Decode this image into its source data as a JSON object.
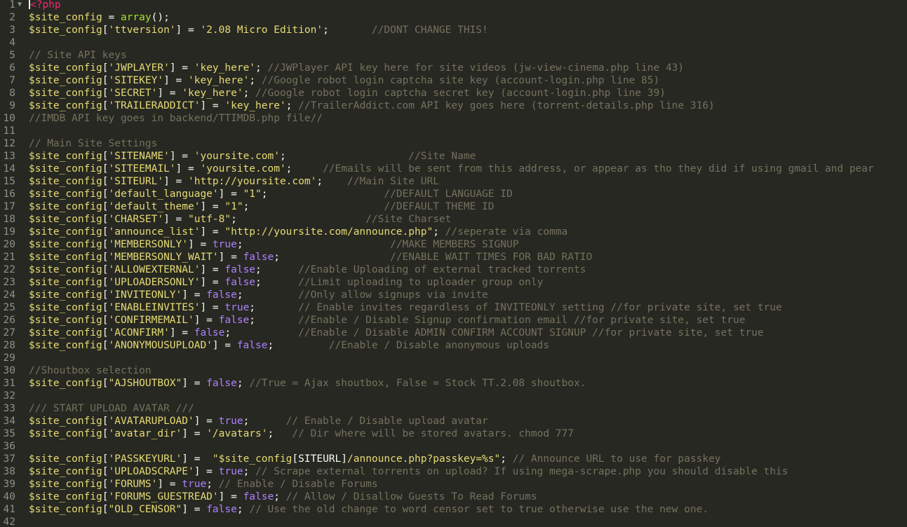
{
  "editor": {
    "colors": {
      "background": "#272822",
      "gutter_text": "#8f908a",
      "plain": "#f8f8f2",
      "variable": "#e6db74",
      "string": "#e6db74",
      "constant": "#ae81ff",
      "function": "#a6e22e",
      "tag": "#f92672",
      "comment": "#75715e"
    },
    "lines": [
      {
        "n": "1",
        "fold": "▼",
        "t": [
          [
            "tag",
            "<?php"
          ]
        ]
      },
      {
        "n": "2",
        "t": [
          [
            "var",
            "$site_config"
          ],
          [
            "plain",
            " = "
          ],
          [
            "fn",
            "array"
          ],
          [
            "plain",
            "();"
          ]
        ]
      },
      {
        "n": "3",
        "t": [
          [
            "var",
            "$site_config"
          ],
          [
            "plain",
            "["
          ],
          [
            "str",
            "'ttversion'"
          ],
          [
            "plain",
            "] = "
          ],
          [
            "str",
            "'2.08 Micro Edition'"
          ],
          [
            "plain",
            ";       "
          ],
          [
            "com",
            "//DONT CHANGE THIS!"
          ]
        ]
      },
      {
        "n": "4",
        "t": []
      },
      {
        "n": "5",
        "t": [
          [
            "com",
            "// Site API keys"
          ]
        ]
      },
      {
        "n": "6",
        "t": [
          [
            "var",
            "$site_config"
          ],
          [
            "plain",
            "["
          ],
          [
            "str",
            "'JWPLAYER'"
          ],
          [
            "plain",
            "] = "
          ],
          [
            "str",
            "'key_here'"
          ],
          [
            "plain",
            "; "
          ],
          [
            "com",
            "//JWPlayer API key here for site videos (jw-view-cinema.php line 43)"
          ]
        ]
      },
      {
        "n": "7",
        "t": [
          [
            "var",
            "$site_config"
          ],
          [
            "plain",
            "["
          ],
          [
            "str",
            "'SITEKEY'"
          ],
          [
            "plain",
            "] = "
          ],
          [
            "str",
            "'key_here'"
          ],
          [
            "plain",
            "; "
          ],
          [
            "com",
            "//Google robot login captcha site key (account-login.php line 85)"
          ]
        ]
      },
      {
        "n": "8",
        "t": [
          [
            "var",
            "$site_config"
          ],
          [
            "plain",
            "["
          ],
          [
            "str",
            "'SECRET'"
          ],
          [
            "plain",
            "] = "
          ],
          [
            "str",
            "'key_here'"
          ],
          [
            "plain",
            "; "
          ],
          [
            "com",
            "//Google robot login captcha secret key (account-login.php line 39)"
          ]
        ]
      },
      {
        "n": "9",
        "t": [
          [
            "var",
            "$site_config"
          ],
          [
            "plain",
            "["
          ],
          [
            "str",
            "'TRAILERADDICT'"
          ],
          [
            "plain",
            "] = "
          ],
          [
            "str",
            "'key_here'"
          ],
          [
            "plain",
            "; "
          ],
          [
            "com",
            "//TrailerAddict.com API key goes here (torrent-details.php line 316)"
          ]
        ]
      },
      {
        "n": "10",
        "t": [
          [
            "com",
            "//IMDB API key goes in backend/TTIMDB.php file//"
          ]
        ]
      },
      {
        "n": "11",
        "t": []
      },
      {
        "n": "12",
        "t": [
          [
            "com",
            "// Main Site Settings"
          ]
        ]
      },
      {
        "n": "13",
        "t": [
          [
            "var",
            "$site_config"
          ],
          [
            "plain",
            "["
          ],
          [
            "str",
            "'SITENAME'"
          ],
          [
            "plain",
            "] = "
          ],
          [
            "str",
            "'yoursite.com'"
          ],
          [
            "plain",
            ";                    "
          ],
          [
            "com",
            "//Site Name"
          ]
        ]
      },
      {
        "n": "14",
        "t": [
          [
            "var",
            "$site_config"
          ],
          [
            "plain",
            "["
          ],
          [
            "str",
            "'SITEEMAIL'"
          ],
          [
            "plain",
            "] = "
          ],
          [
            "str",
            "'yoursite.com'"
          ],
          [
            "plain",
            ";     "
          ],
          [
            "com",
            "//Emails will be sent from this address, or appear as tho they did if using gmail and pear"
          ]
        ]
      },
      {
        "n": "15",
        "t": [
          [
            "var",
            "$site_config"
          ],
          [
            "plain",
            "["
          ],
          [
            "str",
            "'SITEURL'"
          ],
          [
            "plain",
            "] = "
          ],
          [
            "str",
            "'http://yoursite.com'"
          ],
          [
            "plain",
            ";    "
          ],
          [
            "com",
            "//Main Site URL"
          ]
        ]
      },
      {
        "n": "16",
        "t": [
          [
            "var",
            "$site_config"
          ],
          [
            "plain",
            "["
          ],
          [
            "str",
            "'default_language'"
          ],
          [
            "plain",
            "] = "
          ],
          [
            "str",
            "\"1\""
          ],
          [
            "plain",
            ";                   "
          ],
          [
            "com",
            "//DEFAULT LANGUAGE ID"
          ]
        ]
      },
      {
        "n": "17",
        "t": [
          [
            "var",
            "$site_config"
          ],
          [
            "plain",
            "["
          ],
          [
            "str",
            "'default_theme'"
          ],
          [
            "plain",
            "] = "
          ],
          [
            "str",
            "\"1\""
          ],
          [
            "plain",
            ";                      "
          ],
          [
            "com",
            "//DEFAULT THEME ID"
          ]
        ]
      },
      {
        "n": "18",
        "t": [
          [
            "var",
            "$site_config"
          ],
          [
            "plain",
            "["
          ],
          [
            "str",
            "'CHARSET'"
          ],
          [
            "plain",
            "] = "
          ],
          [
            "str",
            "\"utf-8\""
          ],
          [
            "plain",
            ";                     "
          ],
          [
            "com",
            "//Site Charset"
          ]
        ]
      },
      {
        "n": "19",
        "t": [
          [
            "var",
            "$site_config"
          ],
          [
            "plain",
            "["
          ],
          [
            "str",
            "'announce_list'"
          ],
          [
            "plain",
            "] = "
          ],
          [
            "str",
            "\"http://yoursite.com/announce.php\""
          ],
          [
            "plain",
            "; "
          ],
          [
            "com",
            "//seperate via comma"
          ]
        ]
      },
      {
        "n": "20",
        "t": [
          [
            "var",
            "$site_config"
          ],
          [
            "plain",
            "["
          ],
          [
            "str",
            "'MEMBERSONLY'"
          ],
          [
            "plain",
            "] = "
          ],
          [
            "kw",
            "true"
          ],
          [
            "plain",
            ";                        "
          ],
          [
            "com",
            "//MAKE MEMBERS SIGNUP"
          ]
        ]
      },
      {
        "n": "21",
        "t": [
          [
            "var",
            "$site_config"
          ],
          [
            "plain",
            "["
          ],
          [
            "str",
            "'MEMBERSONLY_WAIT'"
          ],
          [
            "plain",
            "] = "
          ],
          [
            "kw",
            "false"
          ],
          [
            "plain",
            ";                  "
          ],
          [
            "com",
            "//ENABLE WAIT TIMES FOR BAD RATIO"
          ]
        ]
      },
      {
        "n": "22",
        "t": [
          [
            "var",
            "$site_config"
          ],
          [
            "plain",
            "["
          ],
          [
            "str",
            "'ALLOWEXTERNAL'"
          ],
          [
            "plain",
            "] = "
          ],
          [
            "kw",
            "false"
          ],
          [
            "plain",
            ";      "
          ],
          [
            "com",
            "//Enable Uploading of external tracked torrents"
          ]
        ]
      },
      {
        "n": "23",
        "t": [
          [
            "var",
            "$site_config"
          ],
          [
            "plain",
            "["
          ],
          [
            "str",
            "'UPLOADERSONLY'"
          ],
          [
            "plain",
            "] = "
          ],
          [
            "kw",
            "false"
          ],
          [
            "plain",
            ";      "
          ],
          [
            "com",
            "//Limit uploading to uploader group only"
          ]
        ]
      },
      {
        "n": "24",
        "t": [
          [
            "var",
            "$site_config"
          ],
          [
            "plain",
            "["
          ],
          [
            "str",
            "'INVITEONLY'"
          ],
          [
            "plain",
            "] = "
          ],
          [
            "kw",
            "false"
          ],
          [
            "plain",
            ";         "
          ],
          [
            "com",
            "//Only allow signups via invite"
          ]
        ]
      },
      {
        "n": "25",
        "t": [
          [
            "var",
            "$site_config"
          ],
          [
            "plain",
            "["
          ],
          [
            "str",
            "'ENABLEINVITES'"
          ],
          [
            "plain",
            "] = "
          ],
          [
            "kw",
            "true"
          ],
          [
            "plain",
            ";       "
          ],
          [
            "com",
            "// Enable invites regardless of INVITEONLY setting //for private site, set true"
          ]
        ]
      },
      {
        "n": "26",
        "t": [
          [
            "var",
            "$site_config"
          ],
          [
            "plain",
            "["
          ],
          [
            "str",
            "'CONFIRMEMAIL'"
          ],
          [
            "plain",
            "] = "
          ],
          [
            "kw",
            "false"
          ],
          [
            "plain",
            ";       "
          ],
          [
            "com",
            "//Enable / Disable Signup confirmation email //for private site, set true"
          ]
        ]
      },
      {
        "n": "27",
        "t": [
          [
            "var",
            "$site_config"
          ],
          [
            "plain",
            "["
          ],
          [
            "str",
            "'ACONFIRM'"
          ],
          [
            "plain",
            "] = "
          ],
          [
            "kw",
            "false"
          ],
          [
            "plain",
            ";           "
          ],
          [
            "com",
            "//Enable / Disable ADMIN CONFIRM ACCOUNT SIGNUP //for private site, set true"
          ]
        ]
      },
      {
        "n": "28",
        "t": [
          [
            "var",
            "$site_config"
          ],
          [
            "plain",
            "["
          ],
          [
            "str",
            "'ANONYMOUSUPLOAD'"
          ],
          [
            "plain",
            "] = "
          ],
          [
            "kw",
            "false"
          ],
          [
            "plain",
            ";         "
          ],
          [
            "com",
            "//Enable / Disable anonymous uploads"
          ]
        ]
      },
      {
        "n": "29",
        "t": []
      },
      {
        "n": "30",
        "t": [
          [
            "com",
            "//Shoutbox selection"
          ]
        ]
      },
      {
        "n": "31",
        "t": [
          [
            "var",
            "$site_config"
          ],
          [
            "plain",
            "["
          ],
          [
            "str",
            "\"AJSHOUTBOX\""
          ],
          [
            "plain",
            "] = "
          ],
          [
            "kw",
            "false"
          ],
          [
            "plain",
            "; "
          ],
          [
            "com",
            "//True = Ajax shoutbox, False = Stock TT.2.08 shoutbox."
          ]
        ]
      },
      {
        "n": "32",
        "t": []
      },
      {
        "n": "33",
        "t": [
          [
            "com",
            "/// START UPLOAD AVATAR ///"
          ]
        ]
      },
      {
        "n": "34",
        "t": [
          [
            "var",
            "$site_config"
          ],
          [
            "plain",
            "["
          ],
          [
            "str",
            "'AVATARUPLOAD'"
          ],
          [
            "plain",
            "] = "
          ],
          [
            "kw",
            "true"
          ],
          [
            "plain",
            ";      "
          ],
          [
            "com",
            "// Enable / Disable upload avatar"
          ]
        ]
      },
      {
        "n": "35",
        "t": [
          [
            "var",
            "$site_config"
          ],
          [
            "plain",
            "["
          ],
          [
            "str",
            "'avatar_dir'"
          ],
          [
            "plain",
            "] = "
          ],
          [
            "str",
            "'/avatars'"
          ],
          [
            "plain",
            ";   "
          ],
          [
            "com",
            "// Dir where will be stored avatars. chmod 777"
          ]
        ]
      },
      {
        "n": "36",
        "t": []
      },
      {
        "n": "37",
        "t": [
          [
            "var",
            "$site_config"
          ],
          [
            "plain",
            "["
          ],
          [
            "str",
            "'PASSKEYURL'"
          ],
          [
            "plain",
            "] =  "
          ],
          [
            "str",
            "\""
          ],
          [
            "var",
            "$site_config"
          ],
          [
            "interp",
            "[SITEURL]"
          ],
          [
            "str",
            "/announce.php?passkey=%s\""
          ],
          [
            "plain",
            "; "
          ],
          [
            "com",
            "// Announce URL to use for passkey"
          ]
        ]
      },
      {
        "n": "38",
        "t": [
          [
            "var",
            "$site_config"
          ],
          [
            "plain",
            "["
          ],
          [
            "str",
            "'UPLOADSCRAPE'"
          ],
          [
            "plain",
            "] = "
          ],
          [
            "kw",
            "true"
          ],
          [
            "plain",
            "; "
          ],
          [
            "com",
            "// Scrape external torrents on upload? If using mega-scrape.php you should disable this"
          ]
        ]
      },
      {
        "n": "39",
        "t": [
          [
            "var",
            "$site_config"
          ],
          [
            "plain",
            "["
          ],
          [
            "str",
            "'FORUMS'"
          ],
          [
            "plain",
            "] = "
          ],
          [
            "kw",
            "true"
          ],
          [
            "plain",
            "; "
          ],
          [
            "com",
            "// Enable / Disable Forums"
          ]
        ]
      },
      {
        "n": "40",
        "t": [
          [
            "var",
            "$site_config"
          ],
          [
            "plain",
            "["
          ],
          [
            "str",
            "'FORUMS_GUESTREAD'"
          ],
          [
            "plain",
            "] = "
          ],
          [
            "kw",
            "false"
          ],
          [
            "plain",
            "; "
          ],
          [
            "com",
            "// Allow / Disallow Guests To Read Forums"
          ]
        ]
      },
      {
        "n": "41",
        "t": [
          [
            "var",
            "$site_config"
          ],
          [
            "plain",
            "["
          ],
          [
            "str",
            "\"OLD_CENSOR\""
          ],
          [
            "plain",
            "] = "
          ],
          [
            "kw",
            "false"
          ],
          [
            "plain",
            "; "
          ],
          [
            "com",
            "// Use the old change to word censor set to true otherwise use the new one."
          ]
        ]
      },
      {
        "n": "42",
        "t": []
      }
    ]
  }
}
